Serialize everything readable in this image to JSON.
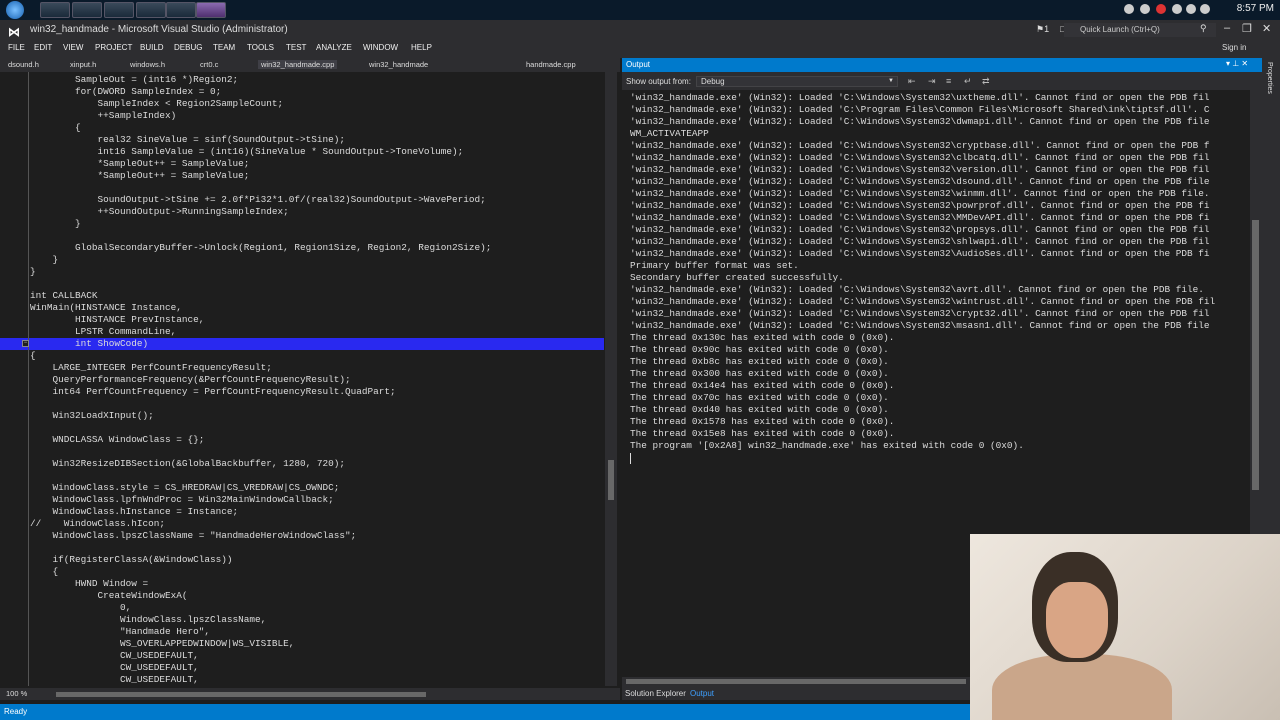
{
  "window": {
    "title": "win32_handmade - Microsoft Visual Studio (Administrator)",
    "quick_launch": "Quick Launch (Ctrl+Q)",
    "notifications": "1",
    "sign_in": "Sign in",
    "clock": "8:57 PM"
  },
  "menu": [
    "FILE",
    "EDIT",
    "VIEW",
    "PROJECT",
    "BUILD",
    "DEBUG",
    "TEAM",
    "TOOLS",
    "TEST",
    "ANALYZE",
    "WINDOW",
    "HELP"
  ],
  "tabs": [
    "dsound.h",
    "xinput.h",
    "windows.h",
    "crt0.c",
    "win32_handmade.cpp",
    "win32_handmade",
    "handmade.cpp"
  ],
  "code_lines": [
    "        SampleOut = (int16 *)Region2;",
    "        for(DWORD SampleIndex = 0;",
    "            SampleIndex < Region2SampleCount;",
    "            ++SampleIndex)",
    "        {",
    "            real32 SineValue = sinf(SoundOutput->tSine);",
    "            int16 SampleValue = (int16)(SineValue * SoundOutput->ToneVolume);",
    "            *SampleOut++ = SampleValue;",
    "            *SampleOut++ = SampleValue;",
    "",
    "            SoundOutput->tSine += 2.0f*Pi32*1.0f/(real32)SoundOutput->WavePeriod;",
    "            ++SoundOutput->RunningSampleIndex;",
    "        }",
    "",
    "        GlobalSecondaryBuffer->Unlock(Region1, Region1Size, Region2, Region2Size);",
    "    }",
    "}",
    "",
    "int CALLBACK",
    "WinMain(HINSTANCE Instance,",
    "        HINSTANCE PrevInstance,",
    "        LPSTR CommandLine,",
    "        int ShowCode)",
    "{",
    "    LARGE_INTEGER PerfCountFrequencyResult;",
    "    QueryPerformanceFrequency(&PerfCountFrequencyResult);",
    "    int64 PerfCountFrequency = PerfCountFrequencyResult.QuadPart;",
    "",
    "    Win32LoadXInput();",
    "",
    "    WNDCLASSA WindowClass = {};",
    "",
    "    Win32ResizeDIBSection(&GlobalBackbuffer, 1280, 720);",
    "",
    "    WindowClass.style = CS_HREDRAW|CS_VREDRAW|CS_OWNDC;",
    "    WindowClass.lpfnWndProc = Win32MainWindowCallback;",
    "    WindowClass.hInstance = Instance;",
    "//    WindowClass.hIcon;",
    "    WindowClass.lpszClassName = \"HandmadeHeroWindowClass\";",
    "",
    "    if(RegisterClassA(&WindowClass))",
    "    {",
    "        HWND Window =",
    "            CreateWindowExA(",
    "                0,",
    "                WindowClass.lpszClassName,",
    "                \"Handmade Hero\",",
    "                WS_OVERLAPPEDWINDOW|WS_VISIBLE,",
    "                CW_USEDEFAULT,",
    "                CW_USEDEFAULT,",
    "                CW_USEDEFAULT,"
  ],
  "editor": {
    "zoom": "100 %"
  },
  "output": {
    "title": "Output",
    "show_from_label": "Show output from:",
    "show_from_value": "Debug",
    "lines": [
      "'win32_handmade.exe' (Win32): Loaded 'C:\\Windows\\System32\\uxtheme.dll'. Cannot find or open the PDB fil",
      "'win32_handmade.exe' (Win32): Loaded 'C:\\Program Files\\Common Files\\Microsoft Shared\\ink\\tiptsf.dll'. C",
      "'win32_handmade.exe' (Win32): Loaded 'C:\\Windows\\System32\\dwmapi.dll'. Cannot find or open the PDB file",
      "WM_ACTIVATEAPP",
      "'win32_handmade.exe' (Win32): Loaded 'C:\\Windows\\System32\\cryptbase.dll'. Cannot find or open the PDB f",
      "'win32_handmade.exe' (Win32): Loaded 'C:\\Windows\\System32\\clbcatq.dll'. Cannot find or open the PDB fil",
      "'win32_handmade.exe' (Win32): Loaded 'C:\\Windows\\System32\\version.dll'. Cannot find or open the PDB fil",
      "'win32_handmade.exe' (Win32): Loaded 'C:\\Windows\\System32\\dsound.dll'. Cannot find or open the PDB file",
      "'win32_handmade.exe' (Win32): Loaded 'C:\\Windows\\System32\\winmm.dll'. Cannot find or open the PDB file.",
      "'win32_handmade.exe' (Win32): Loaded 'C:\\Windows\\System32\\powrprof.dll'. Cannot find or open the PDB fi",
      "'win32_handmade.exe' (Win32): Loaded 'C:\\Windows\\System32\\MMDevAPI.dll'. Cannot find or open the PDB fi",
      "'win32_handmade.exe' (Win32): Loaded 'C:\\Windows\\System32\\propsys.dll'. Cannot find or open the PDB fil",
      "'win32_handmade.exe' (Win32): Loaded 'C:\\Windows\\System32\\shlwapi.dll'. Cannot find or open the PDB fil",
      "'win32_handmade.exe' (Win32): Loaded 'C:\\Windows\\System32\\AudioSes.dll'. Cannot find or open the PDB fi",
      "Primary buffer format was set.",
      "Secondary buffer created successfully.",
      "'win32_handmade.exe' (Win32): Loaded 'C:\\Windows\\System32\\avrt.dll'. Cannot find or open the PDB file.",
      "'win32_handmade.exe' (Win32): Loaded 'C:\\Windows\\System32\\wintrust.dll'. Cannot find or open the PDB fil",
      "'win32_handmade.exe' (Win32): Loaded 'C:\\Windows\\System32\\crypt32.dll'. Cannot find or open the PDB fil",
      "'win32_handmade.exe' (Win32): Loaded 'C:\\Windows\\System32\\msasn1.dll'. Cannot find or open the PDB file",
      "The thread 0x130c has exited with code 0 (0x0).",
      "The thread 0x90c has exited with code 0 (0x0).",
      "The thread 0xb8c has exited with code 0 (0x0).",
      "The thread 0x300 has exited with code 0 (0x0).",
      "The thread 0x14e4 has exited with code 0 (0x0).",
      "The thread 0x70c has exited with code 0 (0x0).",
      "The thread 0xd40 has exited with code 0 (0x0).",
      "The thread 0x1578 has exited with code 0 (0x0).",
      "The thread 0x15e8 has exited with code 0 (0x0).",
      "The program '[0x2A8] win32_handmade.exe' has exited with code 0 (0x0)."
    ]
  },
  "bottom_tabs": [
    "Solution Explorer",
    "Output"
  ],
  "right_strip": "Properties",
  "status": {
    "text": "Ready"
  }
}
